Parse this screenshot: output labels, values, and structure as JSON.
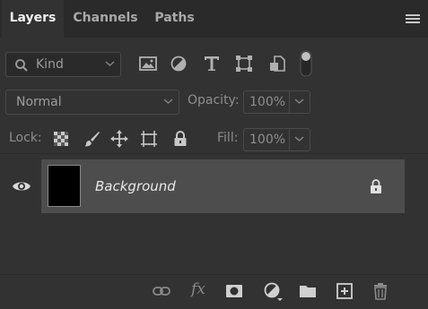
{
  "tabs": [
    {
      "label": "Layers",
      "active": true
    },
    {
      "label": "Channels",
      "active": false
    },
    {
      "label": "Paths",
      "active": false
    }
  ],
  "filter": {
    "kind_label": "Kind",
    "icons": [
      "image-filter-icon",
      "adjustment-filter-icon",
      "type-filter-icon",
      "shape-filter-icon",
      "smart-object-filter-icon",
      "filter-toggle-icon"
    ]
  },
  "blend": {
    "mode": "Normal",
    "opacity_label": "Opacity:",
    "opacity_value": "100%"
  },
  "lock": {
    "label": "Lock:",
    "icons": [
      "lock-transparent-pixels-icon",
      "lock-image-pixels-icon",
      "lock-position-icon",
      "lock-artboard-icon",
      "lock-all-icon"
    ],
    "fill_label": "Fill:",
    "fill_value": "100%"
  },
  "layers": [
    {
      "name": "Background",
      "visible": true,
      "locked": true,
      "thumbnail_color": "#000000"
    }
  ],
  "bottom_bar": {
    "fx_label": "fx",
    "icons": [
      "link-layers-icon",
      "layer-style-icon",
      "layer-mask-icon",
      "adjustment-layer-icon",
      "group-folder-icon",
      "new-layer-icon",
      "delete-layer-icon"
    ]
  },
  "colors": {
    "panel_bg": "#323232",
    "tab_bar_bg": "#2a2a2a",
    "selected_layer_bg": "#4d4d4d"
  }
}
